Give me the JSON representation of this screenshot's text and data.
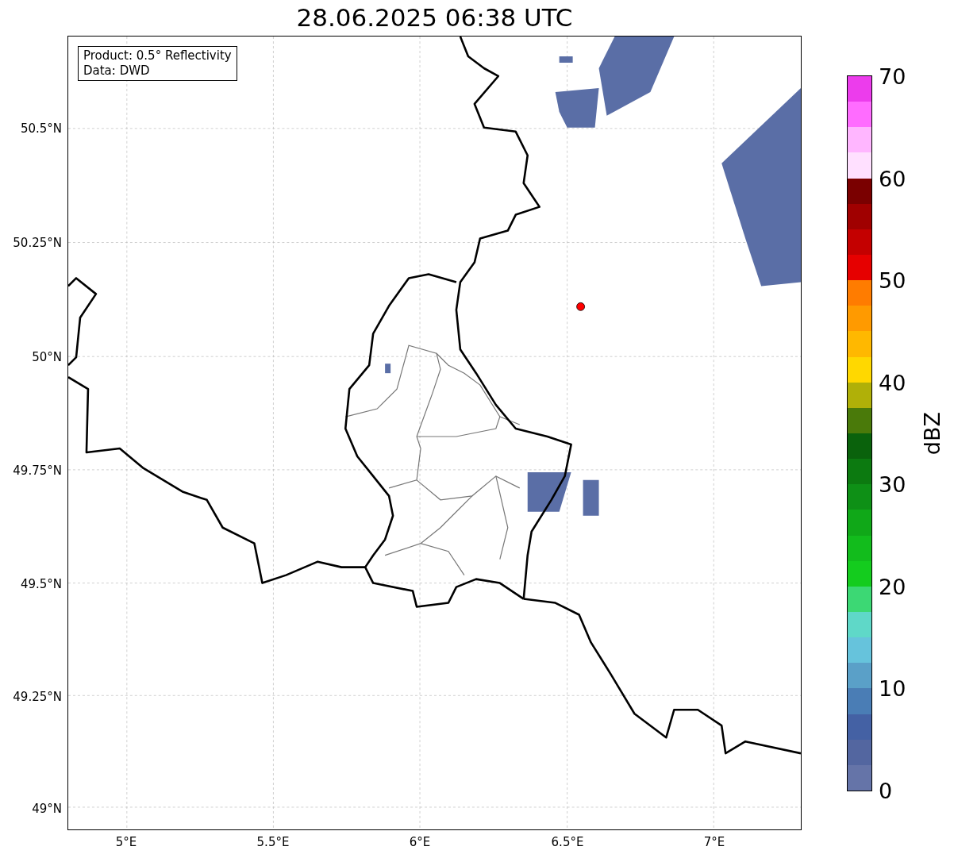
{
  "title": "28.06.2025 06:38 UTC",
  "info_box": {
    "lines": [
      "Product: 0.5° Reflectivity",
      "Data: DWD"
    ]
  },
  "map": {
    "lat_labels": [
      "50.5°N",
      "50.25°N",
      "50°N",
      "49.75°N",
      "49.5°N",
      "49.25°N",
      "49°N"
    ],
    "lon_labels": [
      "5°E",
      "5.5°E",
      "6°E",
      "6.5°E",
      "7°E"
    ]
  },
  "colorbar": {
    "label": "dBZ",
    "ticks": [
      "70",
      "60",
      "50",
      "40",
      "30",
      "20",
      "10",
      "0"
    ],
    "bands": [
      {
        "color": "#ec3cec"
      },
      {
        "color": "#ff6cff"
      },
      {
        "color": "#ffb6ff"
      },
      {
        "color": "#ffe0ff"
      },
      {
        "color": "#7a0000"
      },
      {
        "color": "#a00000"
      },
      {
        "color": "#c40000"
      },
      {
        "color": "#e60000"
      },
      {
        "color": "#ff7c00"
      },
      {
        "color": "#ff9a00"
      },
      {
        "color": "#ffb800"
      },
      {
        "color": "#ffd800"
      },
      {
        "color": "#b0b008"
      },
      {
        "color": "#4a7a0a"
      },
      {
        "color": "#0a620c"
      },
      {
        "color": "#0c7a10"
      },
      {
        "color": "#0e9016"
      },
      {
        "color": "#10a818"
      },
      {
        "color": "#12bc1c"
      },
      {
        "color": "#14cc1e"
      },
      {
        "color": "#3cd874"
      },
      {
        "color": "#5fd8c8"
      },
      {
        "color": "#66c3dc"
      },
      {
        "color": "#5aa0c8"
      },
      {
        "color": "#4a7db5"
      },
      {
        "color": "#4461a4"
      },
      {
        "color": "#5366a0"
      },
      {
        "color": "#6574a8"
      }
    ]
  }
}
